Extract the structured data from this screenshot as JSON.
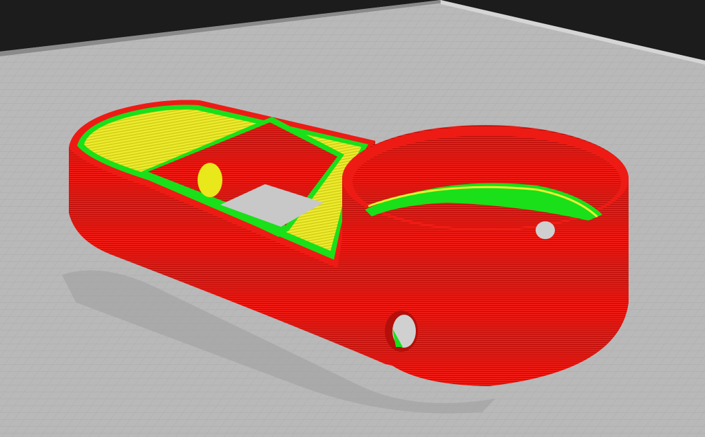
{
  "viewport": {
    "view": "layer-view",
    "background_color": "#1c1c1c",
    "build_plate_color": "#b9b9b9",
    "grid_color": "#a9a9a9"
  },
  "model": {
    "parts": [
      "rounded-base",
      "cylindrical-cup",
      "square-opening",
      "side-holes"
    ],
    "colors": {
      "wall": "#ee1b14",
      "wall_line": "#b40f0a",
      "skin": "#e8e81a",
      "inner_wall": "#19e019"
    }
  }
}
